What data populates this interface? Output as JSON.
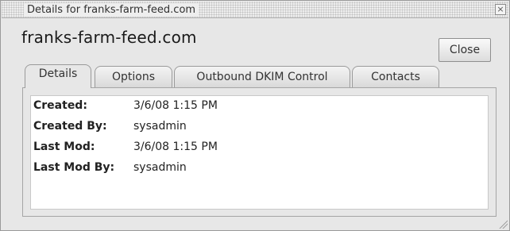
{
  "window": {
    "title": "Details for franks-farm-feed.com",
    "close_glyph": "×"
  },
  "heading": "franks-farm-feed.com",
  "close_button_label": "Close",
  "tabs": [
    {
      "label": "Details",
      "active": true
    },
    {
      "label": "Options",
      "active": false
    },
    {
      "label": "Outbound DKIM Control",
      "active": false
    },
    {
      "label": "Contacts",
      "active": false
    }
  ],
  "details": [
    {
      "label": "Created:",
      "value": "3/6/08 1:15 PM"
    },
    {
      "label": "Created By:",
      "value": "sysadmin"
    },
    {
      "label": "Last Mod:",
      "value": "3/6/08 1:15 PM"
    },
    {
      "label": "Last Mod By:",
      "value": "sysadmin"
    }
  ]
}
